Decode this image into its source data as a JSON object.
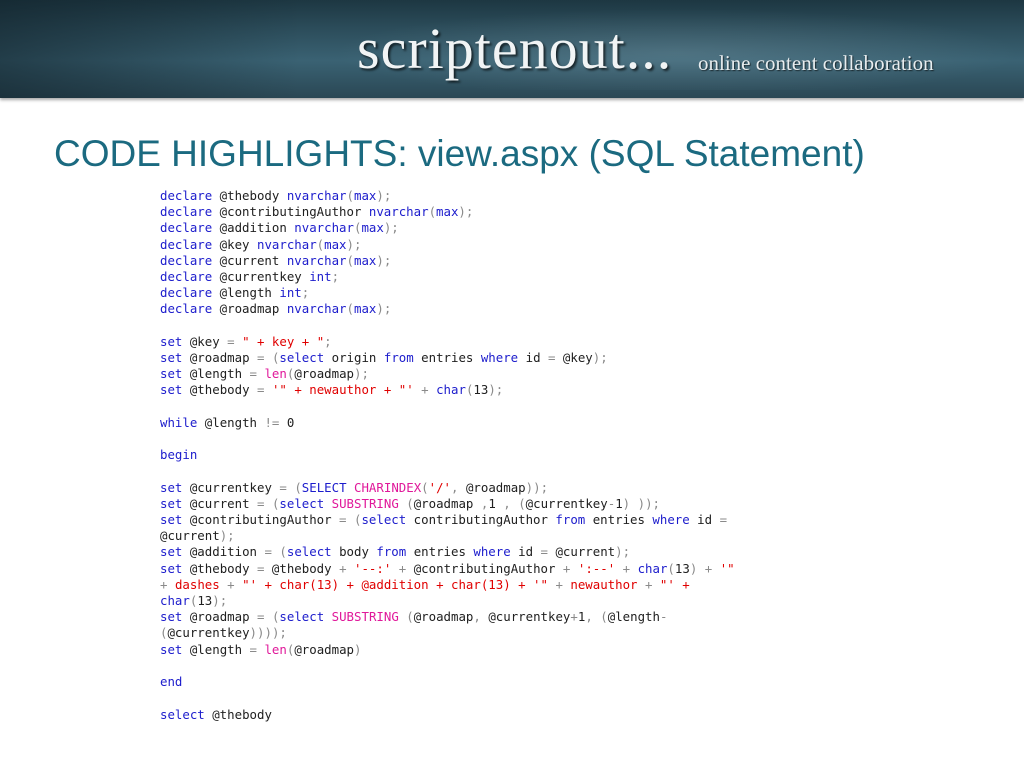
{
  "header": {
    "brand": "scriptenout...",
    "tagline": "online content collaboration"
  },
  "slide": {
    "title": "CODE HIGHLIGHTS: view.aspx (SQL Statement)"
  },
  "code": {
    "language": "SQL",
    "colors": {
      "keyword": "#1c1ccc",
      "function": "#e0189a",
      "string": "#e00000",
      "operator": "#8a8a8a",
      "text": "#202020"
    },
    "lines": [
      "declare @thebody nvarchar(max);",
      "declare @contributingAuthor nvarchar(max);",
      "declare @addition nvarchar(max);",
      "declare @key nvarchar(max);",
      "declare @current nvarchar(max);",
      "declare @currentkey int;",
      "declare @length int;",
      "declare @roadmap nvarchar(max);",
      "",
      "set @key = \" + key + \";",
      "set @roadmap = (select origin from entries where id = @key);",
      "set @length = len(@roadmap);",
      "set @thebody = '\" + newauthor + \"' + char(13);",
      "",
      "while @length != 0",
      "",
      "begin",
      "",
      "set @currentkey = (SELECT CHARINDEX('/', @roadmap));",
      "set @current = (select SUBSTRING (@roadmap ,1 , (@currentkey-1) ));",
      "set @contributingAuthor = (select contributingAuthor from entries where id =",
      "@current);",
      "set @addition = (select body from entries where id = @current);",
      "set @thebody = @thebody + '--:' + @contributingAuthor + ':--' + char(13) + '\"",
      "+ dashes + \"' + char(13) + @addition + char(13) + '\" + newauthor + \"' +",
      "char(13);",
      "set @roadmap = (select SUBSTRING (@roadmap, @currentkey+1, (@length-",
      "(@currentkey))));",
      "set @length = len(@roadmap)",
      "",
      "end",
      "",
      "select @thebody"
    ]
  }
}
